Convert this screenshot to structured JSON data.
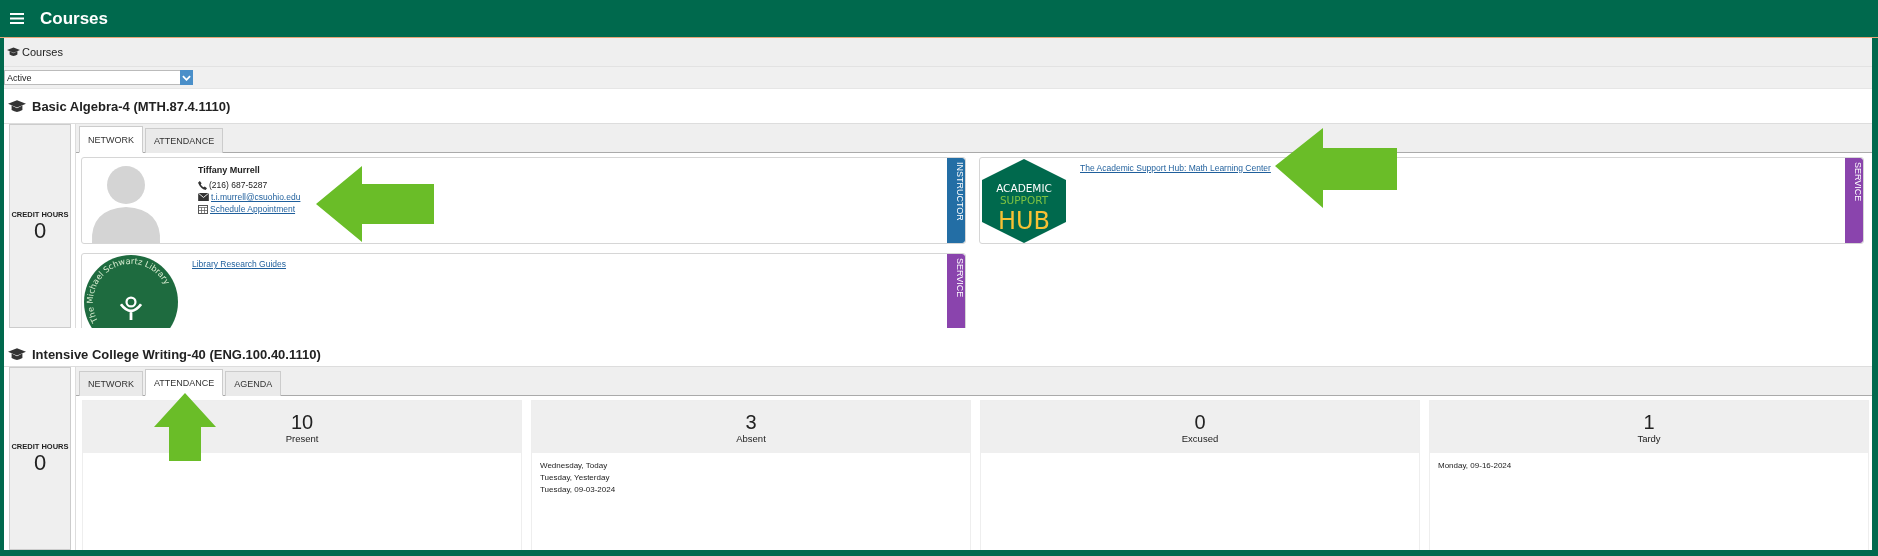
{
  "header": {
    "title": "Courses"
  },
  "breadcrumb": {
    "label": "Courses"
  },
  "filter": {
    "value": "Active"
  },
  "courses": [
    {
      "title": "Basic Algebra-4 (MTH.87.4.1110)",
      "credit_hours_label": "CREDIT HOURS",
      "credit_hours": "0",
      "tabs": [
        {
          "label": "NETWORK",
          "selected": true
        },
        {
          "label": "ATTENDANCE",
          "selected": false
        }
      ],
      "network": [
        {
          "kind": "person",
          "name": "Tiffany Murrell",
          "phone": "(216) 687-5287",
          "email": "t.i.murrell@csuohio.edu",
          "appointment": "Schedule Appointment",
          "tag": "INSTRUCTOR",
          "color": "#236ea5"
        },
        {
          "kind": "hub",
          "logo_text": [
            "ACADEMIC",
            "SUPPORT",
            "HUB"
          ],
          "link": "The Academic Support Hub: Math Learning Center",
          "tag": "SERVICE",
          "color": "#8a44ad"
        },
        {
          "kind": "library",
          "logo_text": "The Michael Schwartz Library",
          "link": "Library Research Guides",
          "tag": "SERVICE",
          "color": "#8a44ad"
        }
      ]
    },
    {
      "title": "Intensive College Writing-40 (ENG.100.40.1110)",
      "credit_hours_label": "CREDIT HOURS",
      "credit_hours": "0",
      "tabs": [
        {
          "label": "NETWORK",
          "selected": false
        },
        {
          "label": "ATTENDANCE",
          "selected": true
        },
        {
          "label": "AGENDA",
          "selected": false
        }
      ],
      "attendance": [
        {
          "count": "10",
          "label": "Present"
        },
        {
          "count": "3",
          "label": "Absent",
          "dates": [
            "Wednesday, Today",
            "Tuesday, Yesterday",
            "Tuesday, 09-03-2024"
          ]
        },
        {
          "count": "0",
          "label": "Excused"
        },
        {
          "count": "1",
          "label": "Tardy",
          "dates": [
            "Monday, 09-16-2024"
          ]
        }
      ]
    }
  ]
}
